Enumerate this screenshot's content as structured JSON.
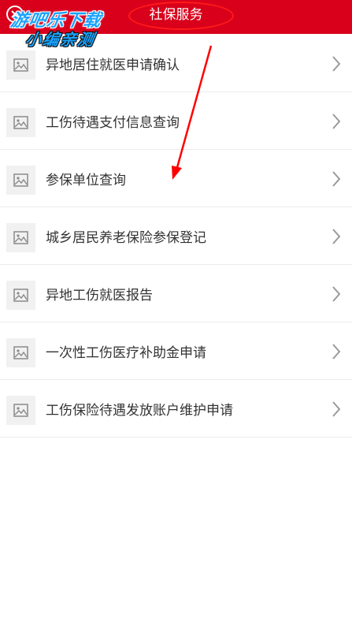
{
  "header": {
    "title": "社保服务",
    "back_icon": "close-circle-icon",
    "bg_color": "#d9001b"
  },
  "watermark": {
    "line1": "游吧乐下载",
    "line2": "小编亲测",
    "color": "#19a3ff"
  },
  "list": {
    "items": [
      {
        "label": "异地居住就医申请确认",
        "icon": "image-placeholder-icon"
      },
      {
        "label": "工伤待遇支付信息查询",
        "icon": "image-placeholder-icon"
      },
      {
        "label": "参保单位查询",
        "icon": "image-placeholder-icon"
      },
      {
        "label": "城乡居民养老保险参保登记",
        "icon": "image-placeholder-icon"
      },
      {
        "label": "异地工伤就医报告",
        "icon": "image-placeholder-icon"
      },
      {
        "label": "一次性工伤医疗补助金申请",
        "icon": "image-placeholder-icon"
      },
      {
        "label": "工伤保险待遇发放账户维护申请",
        "icon": "image-placeholder-icon"
      }
    ]
  },
  "annotation": {
    "color": "#ff0000"
  }
}
